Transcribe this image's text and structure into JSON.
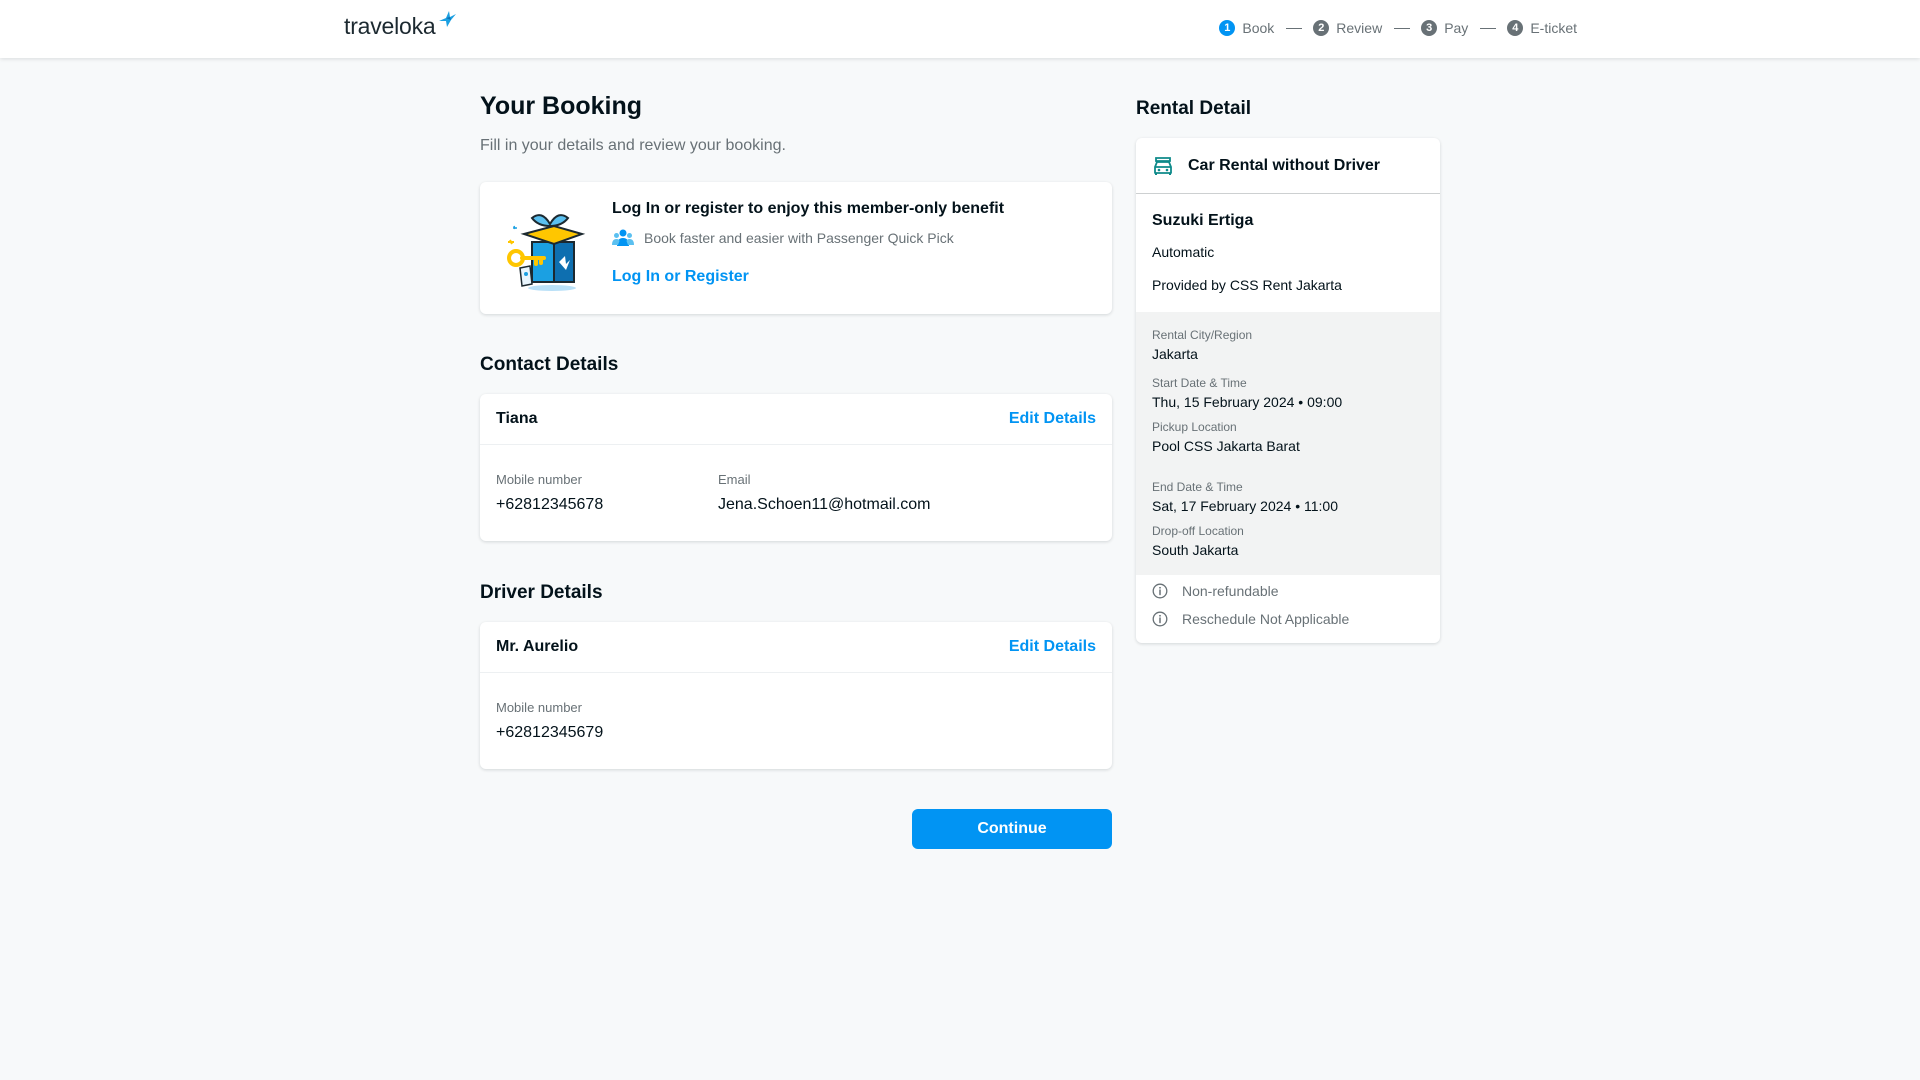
{
  "header": {
    "logo_text": "traveloka",
    "steps": [
      {
        "num": "1",
        "label": "Book"
      },
      {
        "num": "2",
        "label": "Review"
      },
      {
        "num": "3",
        "label": "Pay"
      },
      {
        "num": "4",
        "label": "E-ticket"
      }
    ],
    "active_step": 1,
    "colors": {
      "accent": "#0194f3",
      "step_inactive": "#687176"
    }
  },
  "booking": {
    "title": "Your Booking",
    "subtitle": "Fill in your details and review your booking."
  },
  "login_banner": {
    "title": "Log In or register to enjoy this member-only benefit",
    "benefit": "Book faster and easier with Passenger Quick Pick",
    "link": "Log In or Register",
    "icon": "gift-box-key-icon"
  },
  "contact": {
    "section_title": "Contact Details",
    "name": "Tiana",
    "edit_label": "Edit Details",
    "mobile_label": "Mobile number",
    "mobile": "+62812345678",
    "email_label": "Email",
    "email": "Jena.Schoen11@hotmail.com"
  },
  "driver": {
    "section_title": "Driver Details",
    "name": "Mr. Aurelio",
    "edit_label": "Edit Details",
    "mobile_label": "Mobile number",
    "mobile": "+62812345679"
  },
  "continue_label": "Continue",
  "rental": {
    "section_title": "Rental Detail",
    "product": "Car Rental without Driver",
    "car_name": "Suzuki Ertiga",
    "transmission": "Automatic",
    "provider": "Provided by CSS Rent Jakarta",
    "city_label": "Rental City/Region",
    "city": "Jakarta",
    "start_label": "Start Date & Time",
    "start": "Thu, 15 February 2024 • 09:00",
    "pickup_label": "Pickup Location",
    "pickup": "Pool CSS Jakarta Barat",
    "end_label": "End Date & Time",
    "end": "Sat, 17 February 2024 • 11:00",
    "dropoff_label": "Drop-off Location",
    "dropoff": "South Jakarta",
    "policies": [
      "Non-refundable",
      "Reschedule Not Applicable"
    ]
  }
}
